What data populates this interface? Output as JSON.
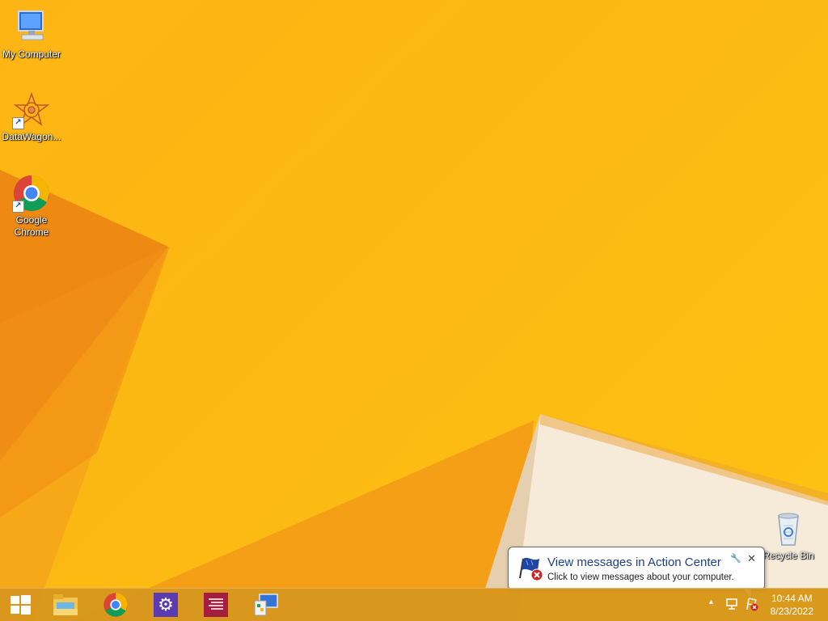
{
  "desktop": {
    "icons": [
      {
        "label": "My Computer",
        "icon": "my-computer-icon"
      },
      {
        "label": "DataWagon...",
        "icon": "datawagon-icon"
      },
      {
        "label": "Google Chrome",
        "icon": "chrome-icon"
      },
      {
        "label": "Recycle Bin",
        "icon": "recycle-bin-icon"
      }
    ]
  },
  "notification": {
    "title": "View messages in Action Center",
    "body": "Click to view messages about your computer.",
    "close_label": "✕",
    "icon": "action-center-flag-icon"
  },
  "taskbar": {
    "apps": [
      {
        "name": "File Explorer",
        "icon": "file-explorer-icon"
      },
      {
        "name": "Google Chrome",
        "icon": "chrome-icon"
      },
      {
        "name": "Settings",
        "icon": "gear-icon"
      },
      {
        "name": "Text Editor",
        "icon": "text-editor-icon"
      },
      {
        "name": "Control Panel",
        "icon": "control-panel-icon"
      }
    ],
    "tray": {
      "overflow_label": "▲",
      "time": "10:44 AM",
      "date": "8/23/2022"
    }
  },
  "colors": {
    "wallpaper": "#fdb515",
    "taskbar": "#d6961e",
    "balloon_title": "#1e3f8a"
  }
}
